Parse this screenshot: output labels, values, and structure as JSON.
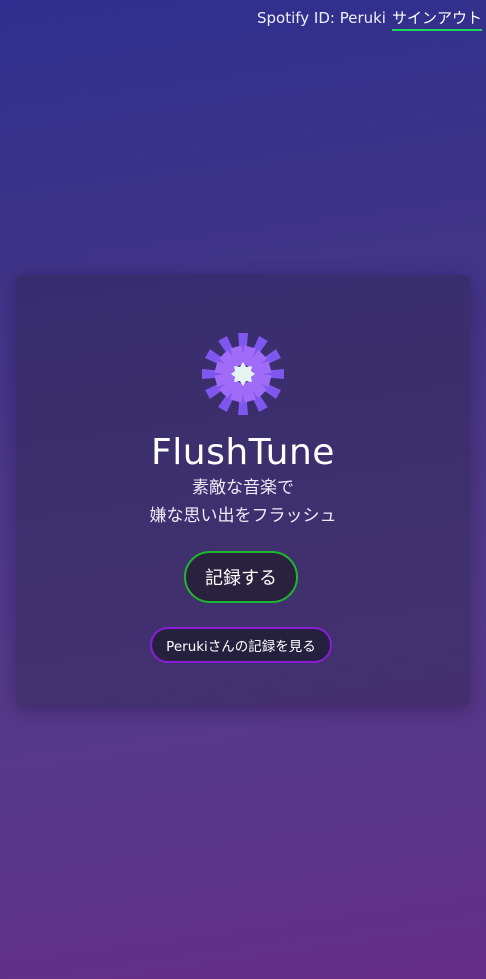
{
  "header": {
    "spotify_id_text": "Spotify ID: Peruki",
    "signout_label": "サインアウト"
  },
  "card": {
    "logo_icon": "flower-burst-icon",
    "title": "FlushTune",
    "tagline_line1": "素敵な音楽で",
    "tagline_line2": "嫌な思い出をフラッシュ",
    "record_button_label": "記録する",
    "history_button_label": "Perukiさんの記録を見る"
  },
  "colors": {
    "signout_underline": "#1ed760",
    "record_button_border": "#1db72f",
    "history_button_border": "#8a1ed6",
    "logo_purple": "#8b5cf6",
    "logo_center": "#e0f2f1"
  }
}
